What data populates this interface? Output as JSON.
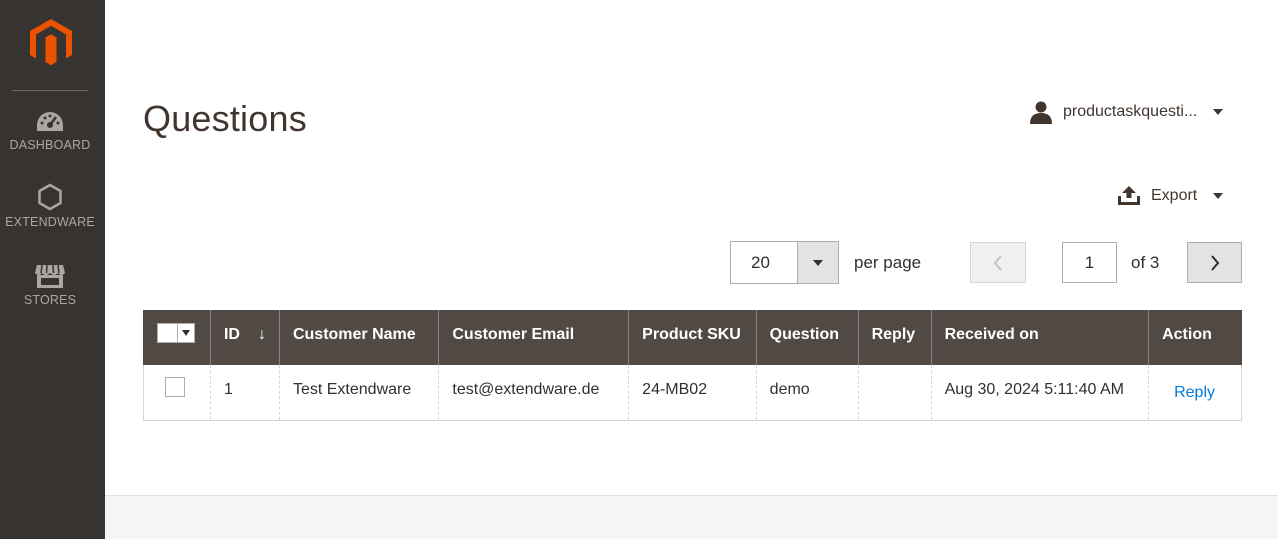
{
  "sidebar": {
    "logo_icon": "magento-logo",
    "items": [
      {
        "label": "DASHBOARD",
        "icon": "dashboard-icon"
      },
      {
        "label": "EXTENDWARE",
        "icon": "hexagon-icon"
      },
      {
        "label": "STORES",
        "icon": "store-icon"
      }
    ]
  },
  "header": {
    "title": "Questions",
    "user_name": "productaskquesti...",
    "export_label": "Export"
  },
  "pager": {
    "per_page_value": "20",
    "per_page_label": "per page",
    "current_page": "1",
    "of_pages": "of 3"
  },
  "grid": {
    "columns": [
      "ID",
      "Customer Name",
      "Customer Email",
      "Product SKU",
      "Question",
      "Reply",
      "Received on",
      "Action"
    ],
    "sort_indicator": "↓",
    "rows": [
      {
        "id": "1",
        "customer_name": "Test Extendware",
        "customer_email": "test@extendware.de",
        "product_sku": "24-MB02",
        "question": "demo",
        "reply": "",
        "received_on": "Aug 30, 2024 5:11:40 AM",
        "action": "Reply"
      }
    ]
  },
  "colors": {
    "sidebar_bg": "#373330",
    "header_row_bg": "#514943",
    "logo_orange": "#eb5202",
    "link_blue": "#007bdb"
  }
}
